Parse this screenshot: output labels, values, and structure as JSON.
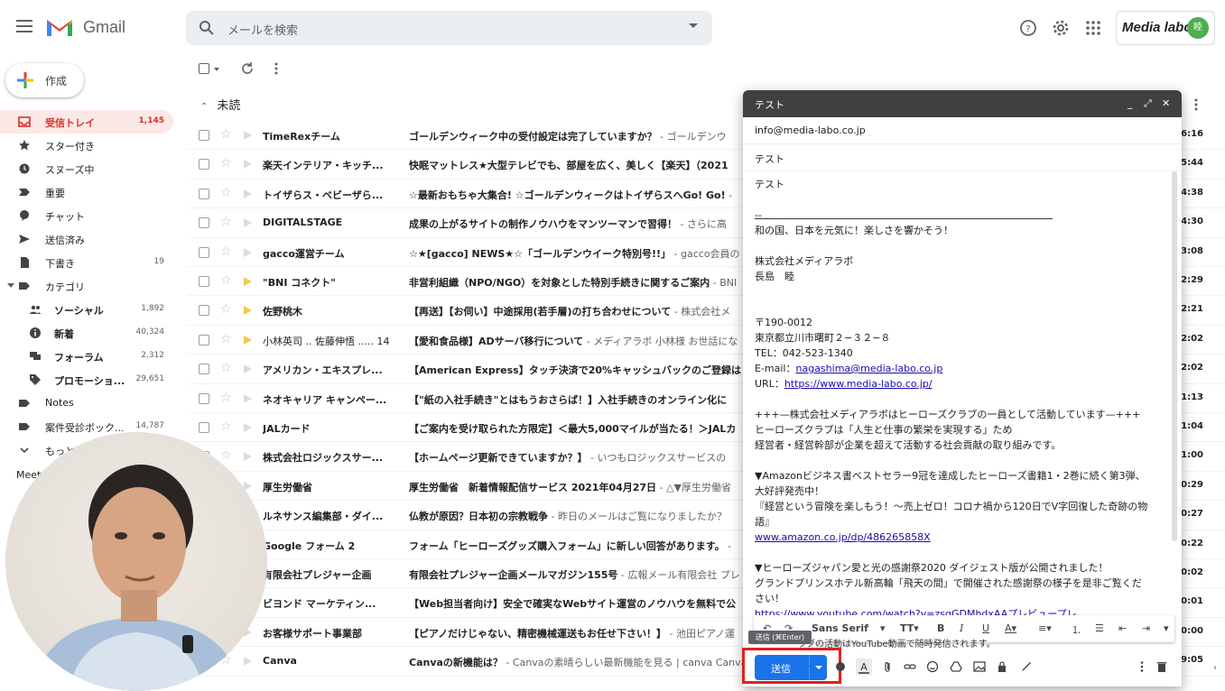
{
  "app": {
    "name": "Gmail",
    "brand": "Media labo",
    "avatar_letter": "睦"
  },
  "search": {
    "placeholder": "メールを検索"
  },
  "compose_label": "作成",
  "nav": [
    {
      "label": "受信トレイ",
      "count": "1,145",
      "icon": "inbox-icon",
      "active": true
    },
    {
      "label": "スター付き",
      "count": "",
      "icon": "star-icon"
    },
    {
      "label": "スヌーズ中",
      "count": "",
      "icon": "clock-icon"
    },
    {
      "label": "重要",
      "count": "",
      "icon": "important-icon"
    },
    {
      "label": "チャット",
      "count": "",
      "icon": "chat-icon"
    },
    {
      "label": "送信済み",
      "count": "",
      "icon": "send-icon"
    },
    {
      "label": "下書き",
      "count": "19",
      "icon": "draft-icon"
    },
    {
      "label": "カテゴリ",
      "count": "",
      "icon": "label-icon",
      "caret": true
    },
    {
      "label": "ソーシャル",
      "count": "1,892",
      "icon": "people-icon",
      "sub": true
    },
    {
      "label": "新着",
      "count": "40,324",
      "icon": "info-icon",
      "sub": true
    },
    {
      "label": "フォーラム",
      "count": "2,312",
      "icon": "forum-icon",
      "sub": true
    },
    {
      "label": "プロモーショ...",
      "count": "29,651",
      "icon": "tag-icon",
      "sub": true
    },
    {
      "label": "Notes",
      "count": "",
      "icon": "label-icon"
    },
    {
      "label": "案件受診ボック...",
      "count": "14,787",
      "icon": "label-icon"
    },
    {
      "label": "もっと",
      "count": "",
      "icon": "chevron-down-icon"
    }
  ],
  "meet_label": "Meet",
  "section_label": "未読",
  "emails": [
    {
      "sender": "TimeRexチーム",
      "subject": "ゴールデンウィーク中の受付設定は完了していますか？",
      "snippet": " - ゴールデンウ",
      "time": "16:16"
    },
    {
      "sender": "楽天インテリア・キッチ...",
      "subject": "快眠マットレス★大型テレビでも、部屋を広く、美しく【楽天】（2021",
      "snippet": "",
      "time": "15:44"
    },
    {
      "sender": "トイザらス・ベビーザら...",
      "subject": "☆最新おもちゃ大集合! ☆ゴールデンウィークはトイザらスへGo! Go!",
      "snippet": " -",
      "time": "14:38"
    },
    {
      "sender": "DIGITALSTAGE",
      "subject": "成果の上がるサイトの制作ノウハウをマンツーマンで習得！",
      "snippet": " - さらに高",
      "time": "14:30"
    },
    {
      "sender": "gacco運営チーム",
      "subject": "☆★[gacco] NEWS★☆「ゴールデンウイーク特別号!!」",
      "snippet": " - gacco会員の",
      "time": "13:08"
    },
    {
      "sender": "\"BNI コネクト\"",
      "subject": "非営利組織（NPO/NGO）を対象とした特別手続きに関するご案内",
      "snippet": " - BNI",
      "time": "12:29",
      "imp": true
    },
    {
      "sender": "佐野桃木",
      "subject": "【再送】【お伺い】中途採用(若手層)の打ち合わせについて",
      "snippet": " - 株式会社メ",
      "time": "12:21",
      "imp": true
    },
    {
      "sender": "小林英司 .. 佐藤伸悟 ..... 14",
      "subject": "【愛和食品様】ADサーバ移行について",
      "snippet": " - メディアラボ 小林様 お世話にな",
      "time": "12:02",
      "imp": true,
      "normal": true
    },
    {
      "sender": "アメリカン・エキスプレ...",
      "subject": "【American Express】タッチ決済で20%キャッシュバックのご登録は",
      "snippet": "",
      "time": "12:02"
    },
    {
      "sender": "ネオキャリア キャンペー...",
      "subject": "【\"紙の入社手続き\"とはもうおさらば！】入社手続きのオンライン化に",
      "snippet": "",
      "time": "11:13"
    },
    {
      "sender": "JALカード",
      "subject": "【ご案内を受け取られた方限定】＜最大5,000マイルが当たる！＞JALカ",
      "snippet": "",
      "time": "11:04"
    },
    {
      "sender": "株式会社ロジックスサー...",
      "subject": "【ホームページ更新できていますか？】",
      "snippet": " - いつもロジックスサービスの",
      "time": "11:00"
    },
    {
      "sender": "厚生労働省",
      "subject": "厚生労働省　新着情報配信サービス 2021年04月27日",
      "snippet": " - △▼厚生労働省",
      "time": "10:29"
    },
    {
      "sender": "ルネサンス編集部・ダイ...",
      "subject": "仏教が原因？日本初の宗教戦争",
      "snippet": " - 昨日のメールはご覧になりましたか？",
      "time": "10:27"
    },
    {
      "sender": "Google フォーム 2",
      "subject": "フォーム「ヒーローズグッズ購入フォーム」に新しい回答があります。",
      "snippet": " -",
      "time": "10:22"
    },
    {
      "sender": "有限会社プレジャー企画",
      "subject": "有限会社プレジャー企画メールマガジン155号",
      "snippet": " - 広報メール有限会社 プレ",
      "time": "10:02"
    },
    {
      "sender": "ビヨンド マーケティン...",
      "subject": "【Web担当者向け】安全で確実なWebサイト運営のノウハウを無料で公",
      "snippet": "",
      "time": "10:01"
    },
    {
      "sender": "お客様サポート事業部",
      "subject": "【ピアノだけじゃない、精密機械運送もお任せ下さい！】",
      "snippet": " - 池田ピアノ運",
      "time": "10:00"
    },
    {
      "sender": "Canva",
      "subject": "Canvaの新機能は？",
      "snippet": " - Canvaの素晴らしい最新機能を見る | canva Canva",
      "time": "9:05"
    }
  ],
  "composer": {
    "title": "テスト",
    "to": "info@media-labo.co.jp",
    "subject": "テスト",
    "body": [
      "テスト",
      "",
      "--",
      "和の国、日本を元気に！楽しさを響かそう！",
      "",
      "株式会社メディアラボ",
      "長島　睦",
      "",
      "",
      "〒190-0012",
      "東京都立川市曙町２−３２−８",
      "TEL：042-523-1340"
    ],
    "email_prefix": "E-mail：",
    "email_link": "nagashima@media-labo.co.jp",
    "url_prefix": "URL：",
    "url_link": "https://www.media-labo.co.jp/",
    "body2": [
      "",
      "+++—株式会社メディアラボはヒーローズクラブの一員として活動しています—+++",
      "ヒーローズクラブは「人生と仕事の繁栄を実現する」ため",
      "経営者・経営幹部が企業を超えて活動する社会貢献の取り組みです。",
      "",
      "▼Amazonビジネス書ベストセラー9冠を達成したヒーローズ書籍1・2巻に続く第3弾、",
      "大好評発売中！",
      "『経営という冒険を楽しもう！〜売上ゼロ！コロナ禍から120日でV字回復した奇跡の物",
      "語』"
    ],
    "amazon_link": "www.amazon.co.jp/dp/486265858X",
    "body3": [
      "",
      "▼ヒーローズジャパン愛と光の感謝祭2020 ダイジェスト版が公開されました！",
      "グランドプリンスホテル新高輪「飛天の間」で開催された感謝祭の様子を是非ご覧くだ",
      "さい！"
    ],
    "youtube_link": "https://www.youtube.com/watch?v=zsqGDMhdxAAプレビュープレ",
    "font_label": "Sans Serif",
    "send_label": "送信",
    "send_tooltip": "送信 (⌘Enter)",
    "hidden_line": "ラブの活動はYouTube動画で随時発信されます。"
  }
}
